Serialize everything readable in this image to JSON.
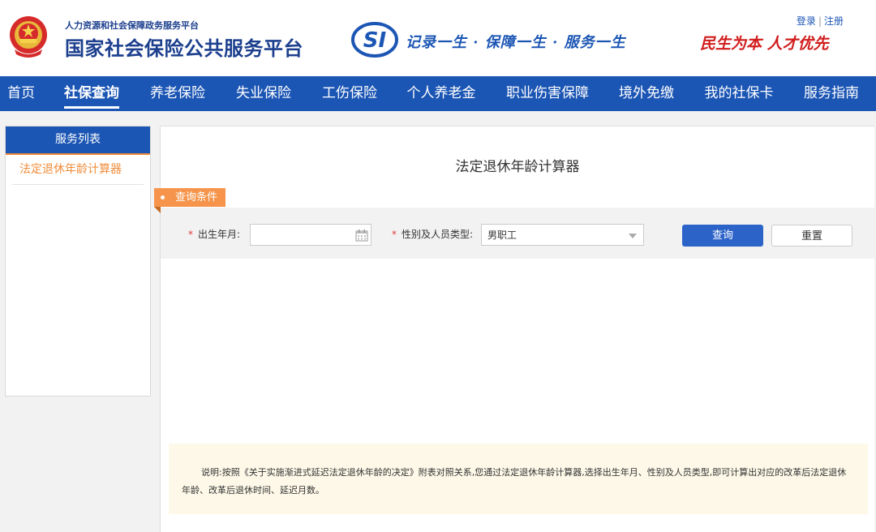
{
  "header": {
    "org_subtitle": "人力资源和社会保障政务服务平台",
    "org_title": "国家社会保险公共服务平台",
    "slogan": "记录一生 · 保障一生 · 服务一生",
    "motto": "民生为本 人才优先",
    "login_label": "登录",
    "register_label": "注册",
    "separator": "|"
  },
  "nav": {
    "items": [
      {
        "label": "首页"
      },
      {
        "label": "社保查询",
        "active": true
      },
      {
        "label": "养老保险"
      },
      {
        "label": "失业保险"
      },
      {
        "label": "工伤保险"
      },
      {
        "label": "个人养老金"
      },
      {
        "label": "职业伤害保障"
      },
      {
        "label": "境外免缴"
      },
      {
        "label": "我的社保卡"
      },
      {
        "label": "服务指南"
      }
    ]
  },
  "sidebar": {
    "title": "服务列表",
    "items": [
      {
        "label": "法定退休年龄计算器"
      }
    ]
  },
  "main": {
    "title": "法定退休年龄计算器",
    "condition_tab": "查询条件",
    "form": {
      "required_mark": "*",
      "birth_label": "出生年月:",
      "birth_value": "",
      "gender_label": "性别及人员类型:",
      "gender_value": "男职工",
      "query_button": "查询",
      "reset_button": "重置"
    },
    "note": "说明:按照《关于实施渐进式延迟法定退休年龄的决定》附表对照关系,您通过法定退休年龄计算器,选择出生年月、性别及人员类型,即可计算出对应的改革后法定退休年龄、改革后退休时间、延迟月数。"
  },
  "colors": {
    "brand_blue": "#1c56b4",
    "accent_orange": "#f5944a",
    "motto_red": "#d11c1c",
    "note_bg": "#fdf8e8"
  }
}
